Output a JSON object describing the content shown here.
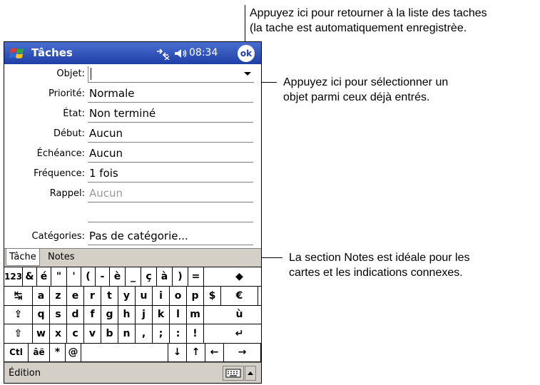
{
  "callouts": {
    "ok": [
      "Appuyez ici pour retourner à la liste des taches",
      "(la tache est automatiquement enregistrèe."
    ],
    "subject": [
      "Appuyez ici pour sélectionner un",
      "objet parmi ceux déjà entrés."
    ],
    "notes": [
      "La section Notes est idéale pour les",
      "cartes et les indications connexes."
    ]
  },
  "titlebar": {
    "title": "Tâches",
    "clock": "08:34",
    "ok_label": "ok"
  },
  "form": {
    "fields": [
      {
        "label": "Objet:",
        "value": ""
      },
      {
        "label": "Priorité:",
        "value": "Normale"
      },
      {
        "label": "État:",
        "value": "Non terminé"
      },
      {
        "label": "Début:",
        "value": "Aucun"
      },
      {
        "label": "Échéance:",
        "value": "Aucun"
      },
      {
        "label": "Fréquence:",
        "value": "1 fois"
      },
      {
        "label": "Rappel:",
        "value": "Aucun"
      },
      {
        "label": "",
        "value": ""
      },
      {
        "label": "Catégories:",
        "value": "Pas de catégorie..."
      }
    ]
  },
  "tabs": [
    "Tâche",
    "Notes"
  ],
  "keyboard": {
    "rows": [
      [
        "123",
        "&",
        "é",
        "\"",
        "'",
        "(",
        "-",
        "è",
        "_",
        "ç",
        "à",
        ")",
        "=",
        "◆"
      ],
      [
        "↹",
        "a",
        "z",
        "e",
        "r",
        "t",
        "y",
        "u",
        "i",
        "o",
        "p",
        "$",
        "€"
      ],
      [
        "⇪",
        "q",
        "s",
        "d",
        "f",
        "g",
        "h",
        "j",
        "k",
        "l",
        "m",
        "ù"
      ],
      [
        "⇧",
        "w",
        "x",
        "c",
        "v",
        "b",
        "n",
        ",",
        ";",
        ":",
        "!",
        "↵"
      ],
      [
        "Ctl",
        "âë",
        "*",
        "@",
        " ",
        "↓",
        "↑",
        "←",
        "→"
      ]
    ]
  },
  "menubar": {
    "edit_label": "Édition"
  },
  "colors": {
    "titlebar": "#1f3fa6",
    "bars": "#d4d0c8",
    "dim_text": "#9a9a9a"
  }
}
